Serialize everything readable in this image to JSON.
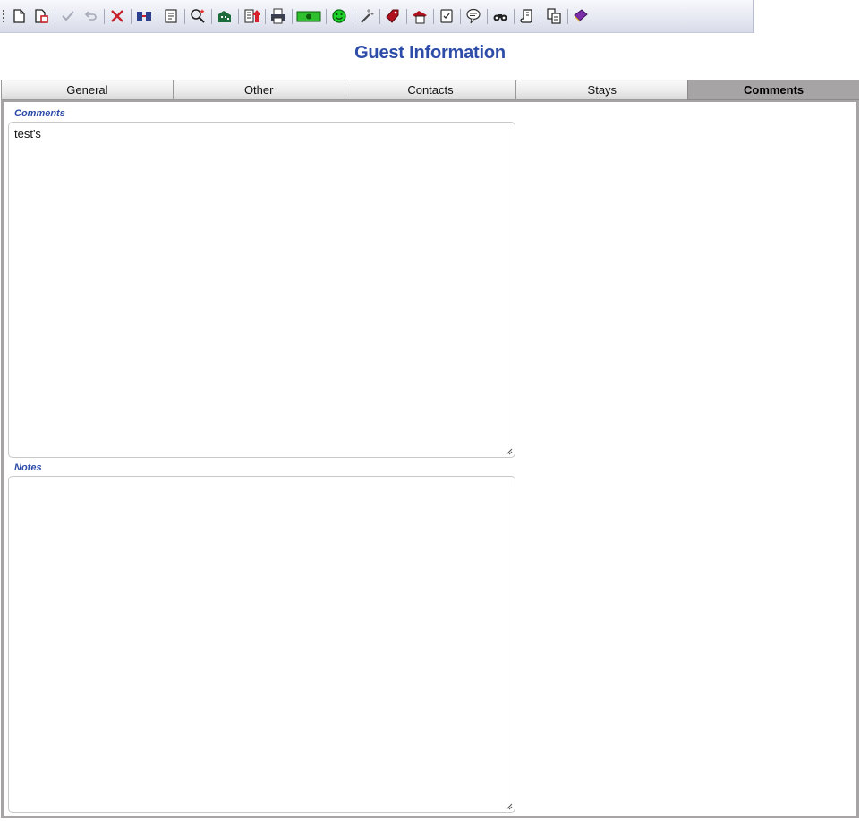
{
  "toolbar": {
    "icons": [
      "new-document-icon",
      "copy-document-icon",
      "checkmark-icon",
      "undo-icon",
      "delete-icon",
      "merge-icon",
      "form-icon",
      "search-star-icon",
      "building-icon",
      "export-icon",
      "print-icon",
      "money-icon",
      "smiley-icon",
      "magic-wand-icon",
      "tag-icon",
      "layers-icon",
      "checklist-icon",
      "speech-bubble-icon",
      "binoculars-icon",
      "scroll-icon",
      "copy-pages-icon",
      "book-icon"
    ]
  },
  "page": {
    "title": "Guest Information"
  },
  "tabs": [
    {
      "label": "General",
      "active": false
    },
    {
      "label": "Other",
      "active": false
    },
    {
      "label": "Contacts",
      "active": false
    },
    {
      "label": "Stays",
      "active": false
    },
    {
      "label": "Comments",
      "active": true
    }
  ],
  "fields": {
    "comments": {
      "label": "Comments",
      "value": "test's"
    },
    "notes": {
      "label": "Notes",
      "value": ""
    }
  },
  "colors": {
    "accent": "#2d4ba8",
    "active_tab": "#a7a4a6"
  }
}
